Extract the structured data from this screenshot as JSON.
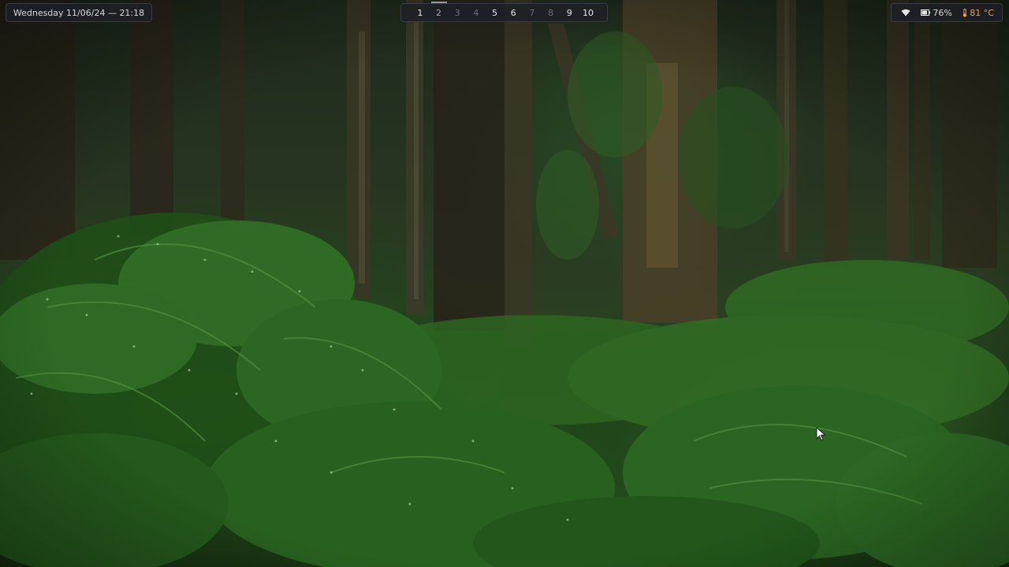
{
  "topbar": {
    "clock": {
      "datetime": "Wednesday 11/06/24 — 21:18"
    },
    "workspaces": [
      {
        "label": "1",
        "state": "occupied"
      },
      {
        "label": "2",
        "state": "active"
      },
      {
        "label": "3",
        "state": "empty"
      },
      {
        "label": "4",
        "state": "empty"
      },
      {
        "label": "5",
        "state": "occupied"
      },
      {
        "label": "6",
        "state": "occupied"
      },
      {
        "label": "7",
        "state": "empty"
      },
      {
        "label": "8",
        "state": "empty"
      },
      {
        "label": "9",
        "state": "occupied"
      },
      {
        "label": "10",
        "state": "occupied"
      }
    ],
    "status": {
      "wifi_icon": "wifi-icon",
      "battery_icon": "battery-icon",
      "battery": "76%",
      "temp_icon": "thermometer-icon",
      "temperature": "81 °C",
      "temperature_color": "#e8a15a"
    }
  },
  "wallpaper": {
    "subject": "forest-ferns"
  }
}
